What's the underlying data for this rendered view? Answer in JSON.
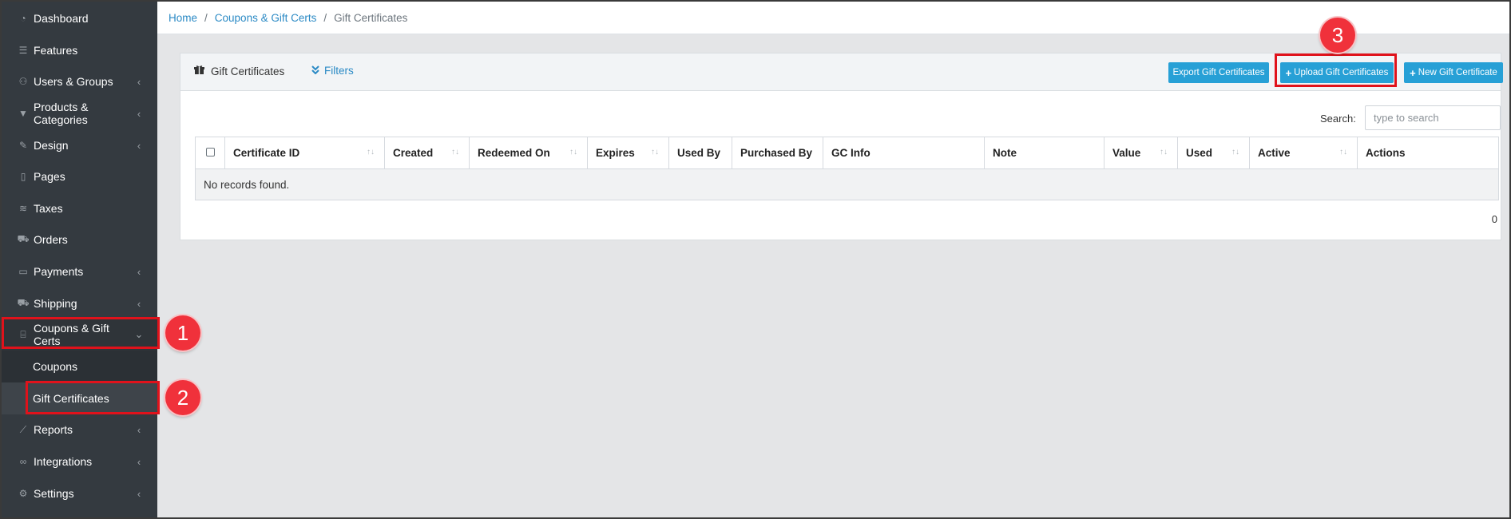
{
  "sidebar": {
    "items": [
      {
        "label": "Dashboard",
        "icon": "dashboard-icon",
        "glyph": "◔",
        "chevron": ""
      },
      {
        "label": "Features",
        "icon": "list-icon",
        "glyph": "☰",
        "chevron": ""
      },
      {
        "label": "Users & Groups",
        "icon": "users-icon",
        "glyph": "⚇",
        "chevron": "‹"
      },
      {
        "label": "Products & Categories",
        "icon": "shirt-icon",
        "glyph": "▼",
        "chevron": "‹"
      },
      {
        "label": "Design",
        "icon": "brush-icon",
        "glyph": "✎",
        "chevron": "‹"
      },
      {
        "label": "Pages",
        "icon": "page-icon",
        "glyph": "▯",
        "chevron": ""
      },
      {
        "label": "Taxes",
        "icon": "coins-icon",
        "glyph": "≋",
        "chevron": ""
      },
      {
        "label": "Orders",
        "icon": "cart-icon",
        "glyph": "⛟",
        "chevron": ""
      },
      {
        "label": "Payments",
        "icon": "credit-card-icon",
        "glyph": "▭",
        "chevron": "‹"
      },
      {
        "label": "Shipping",
        "icon": "truck-icon",
        "glyph": "⛟",
        "chevron": "‹"
      },
      {
        "label": "Coupons & Gift Certs",
        "icon": "gift-icon",
        "glyph": "⌸",
        "chevron": "⌄"
      },
      {
        "label": "Coupons",
        "icon": "",
        "glyph": "",
        "chevron": ""
      },
      {
        "label": "Gift Certificates",
        "icon": "",
        "glyph": "",
        "chevron": ""
      },
      {
        "label": "Reports",
        "icon": "chart-icon",
        "glyph": "⟋",
        "chevron": "‹"
      },
      {
        "label": "Integrations",
        "icon": "link-icon",
        "glyph": "∞",
        "chevron": "‹"
      },
      {
        "label": "Settings",
        "icon": "gear-icon",
        "glyph": "⚙",
        "chevron": "‹"
      }
    ]
  },
  "breadcrumb": {
    "home": "Home",
    "parent": "Coupons & Gift Certs",
    "current": "Gift Certificates",
    "sep": "/"
  },
  "card": {
    "title": "Gift Certificates",
    "filters_label": "Filters",
    "buttons": {
      "export": "Export Gift Certificates",
      "upload": "Upload Gift Certificates",
      "new": "New Gift Certificate",
      "plus": "+"
    },
    "search_label": "Search:",
    "search_placeholder": "type to search",
    "columns": [
      "Certificate ID",
      "Created",
      "Redeemed On",
      "Expires",
      "Used By",
      "Purchased By",
      "GC Info",
      "Note",
      "Value",
      "Used",
      "Active",
      "Actions"
    ],
    "empty_text": "No records found.",
    "record_count": "0"
  },
  "annotations": {
    "one": "1",
    "two": "2",
    "three": "3"
  },
  "colors": {
    "sidebar_bg": "#343a40",
    "accent_button": "#27a0d6",
    "link": "#2b8ac5",
    "highlight": "#e0121b"
  }
}
